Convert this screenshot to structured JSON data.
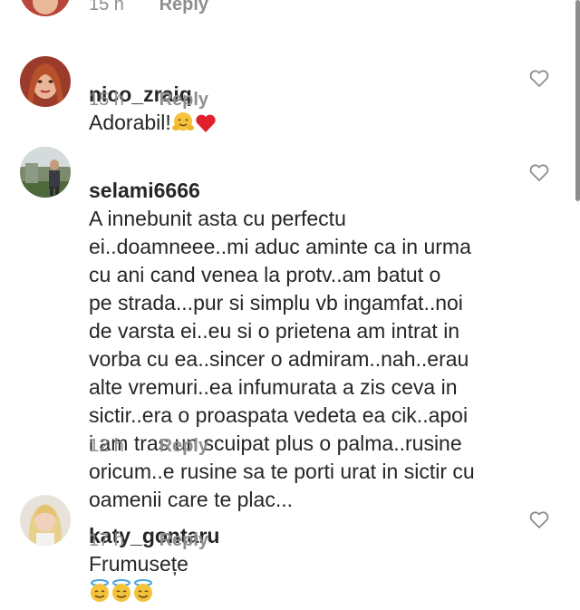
{
  "top": {
    "time": "15 h",
    "reply": "Reply"
  },
  "comments": [
    {
      "username": "nico_zraiq",
      "text": "Adorabil!",
      "time": "15 h",
      "reply": "Reply",
      "emoji": [
        "hugging-face-emoji",
        "red-heart-emoji"
      ]
    },
    {
      "username": "selami6666",
      "text": "A innebunit asta cu perfectu\nei..doamneee..mi aduc aminte ca in urma\ncu ani cand venea la protv..am batut o\npe strada...pur si simplu vb ingamfat..noi\nde varsta ei..eu si o prietena am intrat in\nvorba cu ea..sincer o admiram..nah..erau\nalte vremuri..ea infumurata a zis ceva in\nsictir..era o proaspata vedeta ea cik..apoi\ni am tras un scuipat plus o palma..rusine\noricum..e rusine sa te porti urat in sictir cu\noamenii care te plac...",
      "time": "12 h",
      "reply": "Reply"
    },
    {
      "username": "katy_gontaru",
      "text": "Frumusețe",
      "time": "17 h",
      "reply": "Reply",
      "emoji": [
        "smiling-face-with-halo-emoji",
        "smiling-face-with-halo-emoji",
        "smiling-face-with-halo-emoji"
      ]
    }
  ],
  "colors": {
    "text": "#262626",
    "meta": "#8e8e8e",
    "emoji": "#f5c33b"
  }
}
